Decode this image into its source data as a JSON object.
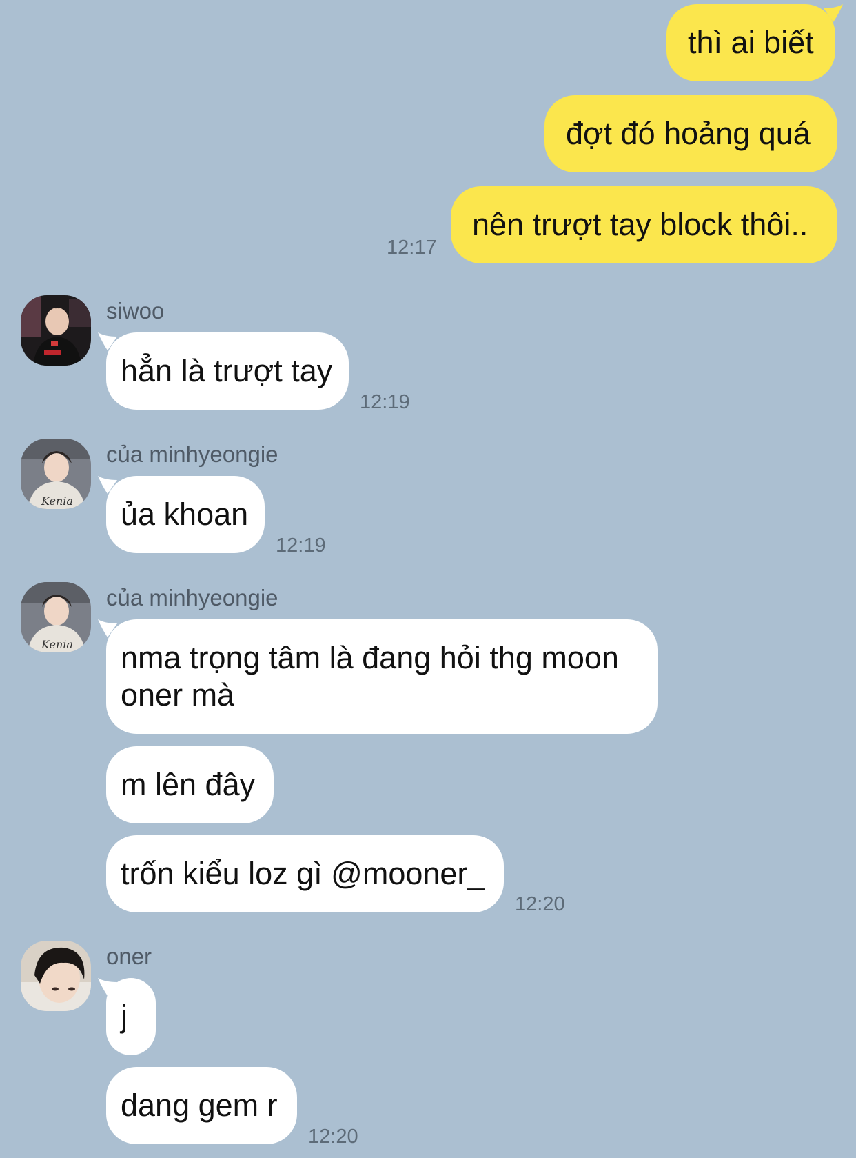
{
  "colors": {
    "background": "#abbfd1",
    "outgoing_bubble": "#fbe64d",
    "incoming_bubble": "#ffffff"
  },
  "outgoing": {
    "messages": [
      "thì ai biết",
      "đợt đó hoảng quá",
      "nên trượt tay block thôi.."
    ],
    "time": "12:17"
  },
  "groups": [
    {
      "sender": "siwoo",
      "avatar_icon": "avatar-siwoo",
      "messages": [
        "hẳn là trượt tay"
      ],
      "time": "12:19"
    },
    {
      "sender": "của minhyeongie",
      "avatar_icon": "avatar-minhyeongie",
      "messages": [
        "ủa khoan"
      ],
      "time": "12:19"
    },
    {
      "sender": "của minhyeongie",
      "avatar_icon": "avatar-minhyeongie",
      "messages": [
        "nma trọng tâm là đang hỏi thg moon oner mà",
        "m lên đây",
        "trốn kiểu loz gì @mooner_"
      ],
      "time": "12:20"
    },
    {
      "sender": "oner",
      "avatar_icon": "avatar-oner",
      "messages": [
        "j",
        "dang gem r"
      ],
      "time": "12:20"
    }
  ]
}
